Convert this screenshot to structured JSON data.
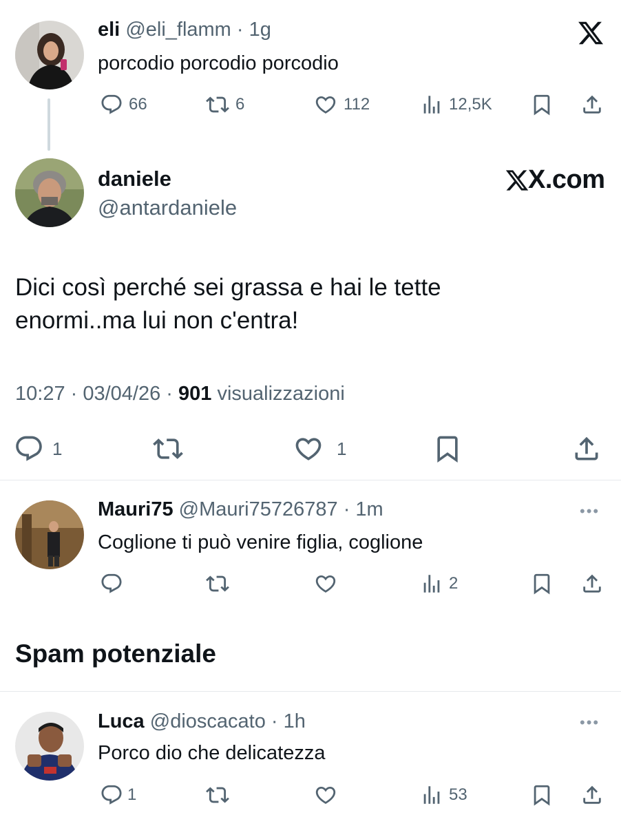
{
  "colors": {
    "text": "#0f1419",
    "muted": "#536471",
    "divider": "#e6e9ec",
    "background": "#ffffff"
  },
  "tweet1": {
    "display_name": "eli",
    "handle": "@eli_flamm",
    "time": "· 1g",
    "text": "porcodio porcodio porcodio",
    "replies": "66",
    "retweets": "6",
    "likes": "112",
    "views": "12,5K",
    "brand_icon": "x-logo-icon"
  },
  "tweet2": {
    "display_name": "daniele",
    "handle": "@antardaniele",
    "brand": "X.com",
    "text_line1": "Dici così perché sei grassa e hai le tette",
    "text_line2": "enormi..ma lui non c'entra!",
    "timestamp": "10:27 · 03/04/26 ·",
    "views_count": "901",
    "views_label": "visualizzazioni",
    "replies": "1",
    "likes": "1"
  },
  "reply1": {
    "display_name": "Mauri75",
    "handle": "@Mauri75726787",
    "time": "· 1m",
    "text": "Coglione ti può venire figlia, coglione",
    "views": "2",
    "more": "•••"
  },
  "section_title": "Spam potenziale",
  "reply2": {
    "display_name": "Luca",
    "handle": "@dioscacato",
    "time": "· 1h",
    "text": "Porco dio che delicatezza",
    "replies": "1",
    "views": "53",
    "more": "•••"
  }
}
